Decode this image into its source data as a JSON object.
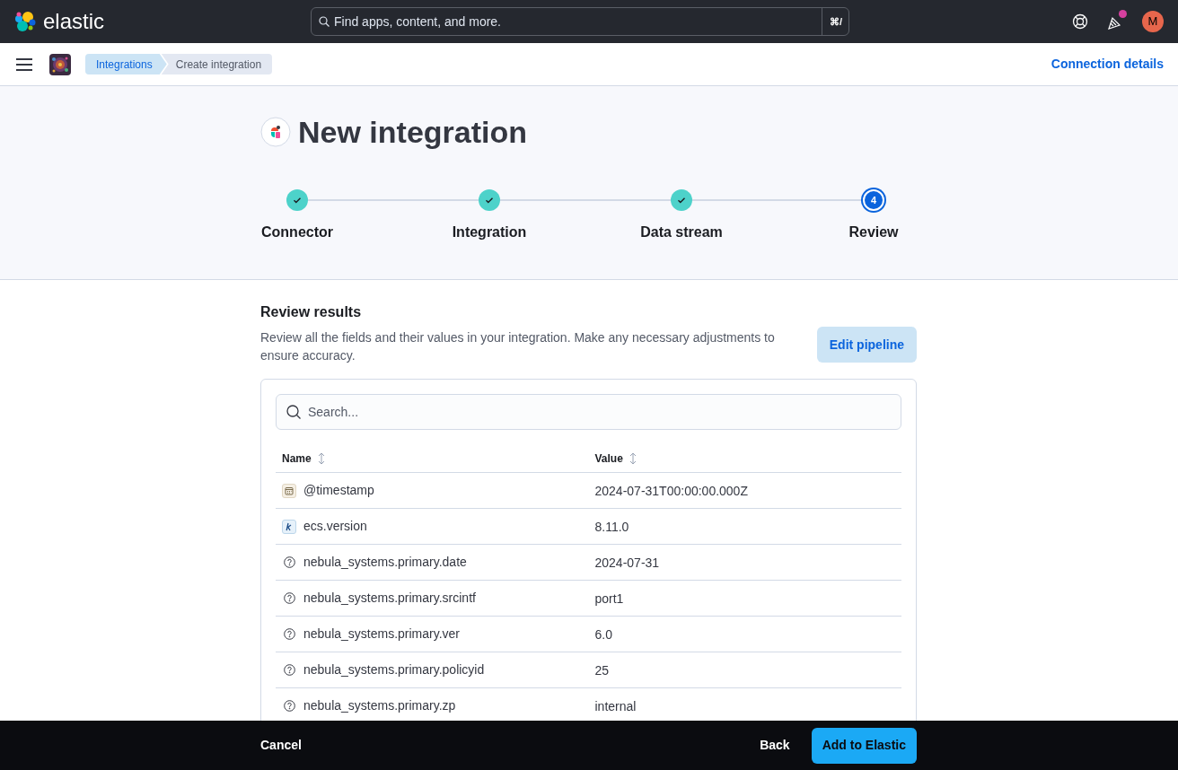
{
  "header": {
    "logo_text": "elastic",
    "search": {
      "placeholder": "Find apps, content, and more."
    },
    "shortcut": "⌘/",
    "avatar": "M",
    "has_news": true
  },
  "subheader": {
    "breadcrumbs": [
      {
        "label": "Integrations",
        "selected": false
      },
      {
        "label": "Create integration",
        "selected": true
      }
    ],
    "link": "Connection details"
  },
  "page": {
    "title": "New integration"
  },
  "steps": [
    {
      "label": "Connector",
      "completed": true,
      "selected": false
    },
    {
      "label": "Integration",
      "completed": true,
      "selected": false
    },
    {
      "label": "Data stream",
      "completed": true,
      "selected": false
    },
    {
      "label": "Review",
      "completed": false,
      "selected": true,
      "number": "4"
    }
  ],
  "review": {
    "title": "Review results",
    "description": "Review all the fields and their values in your integration. Make any necessary adjustments to ensure accuracy.",
    "button": "Edit pipeline",
    "search": {
      "placeholder": "Search..."
    },
    "columns": [
      "Name",
      "Value"
    ],
    "rows": [
      {
        "kind": "date",
        "name": "@timestamp",
        "value": "2024-07-31T00:00:00.000Z"
      },
      {
        "kind": "keyword",
        "name": "ecs.version",
        "value": "8.11.0"
      },
      {
        "kind": "unknown",
        "name": "nebula_systems.primary.date",
        "value": "2024-07-31"
      },
      {
        "kind": "unknown",
        "name": "nebula_systems.primary.srcintf",
        "value": "port1"
      },
      {
        "kind": "unknown",
        "name": "nebula_systems.primary.ver",
        "value": "6.0"
      },
      {
        "kind": "unknown",
        "name": "nebula_systems.primary.policyid",
        "value": "25"
      },
      {
        "kind": "unknown",
        "name": "nebula_systems.primary.zp",
        "value": "internal"
      }
    ]
  },
  "footer": {
    "cancel": "Cancel",
    "back": "Back",
    "primary": "Add to Elastic"
  }
}
